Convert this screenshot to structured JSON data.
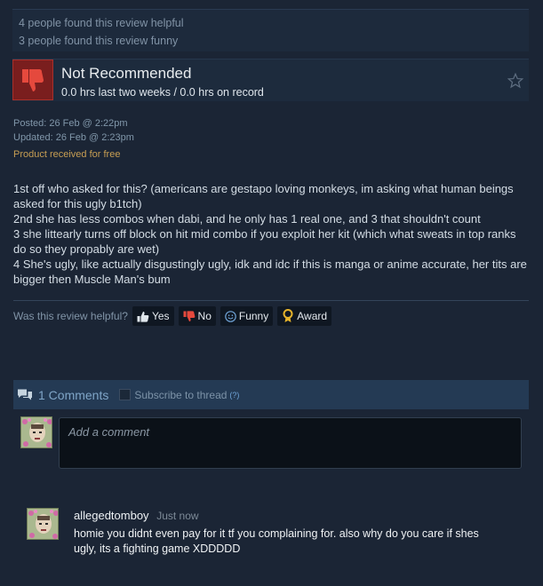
{
  "stats": {
    "helpful": "4 people found this review helpful",
    "funny": "3 people found this review funny"
  },
  "recommendation": {
    "title": "Not Recommended",
    "hours": "0.0 hrs last two weeks / 0.0 hrs on record",
    "thumb_icon": "thumbs-down-icon",
    "star_icon": "star-icon"
  },
  "dates": {
    "posted": "Posted: 26 Feb @ 2:22pm",
    "updated": "Updated: 26 Feb @ 2:23pm",
    "received": "Product received for free"
  },
  "review": {
    "paragraphs": [
      "1st off who asked for this? (americans are gestapo loving monkeys, im asking what human beings asked for this ugly b1tch)",
      "2nd she has less combos when dabi, and he only has 1 real one, and 3 that shouldn't count",
      "3 she littearly turns off block on hit mid combo if you exploit her kit (which what sweats in top ranks do so they propably are wet)",
      "4 She's ugly, like actually disgustingly ugly, idk and idc if this is manga or anime accurate, her tits are bigger then Muscle Man's bum"
    ]
  },
  "helpful_prompt": {
    "question": "Was this review helpful?",
    "yes": "Yes",
    "no": "No",
    "funny": "Funny",
    "award": "Award"
  },
  "comments": {
    "count_label": "1 Comments",
    "subscribe": "Subscribe to thread",
    "help": "(?)",
    "placeholder": "Add a comment",
    "items": [
      {
        "author": "allegedtomboy",
        "time": "Just now",
        "text": "homie you didnt even pay for it tf you complaining for. also why do you care if shes ugly, its a fighting game XDDDDD"
      }
    ]
  },
  "colors": {
    "background": "#1b2535",
    "not_recommended": "#7a1e1e",
    "free_label": "#c79e53",
    "link": "#6fa3d6"
  }
}
